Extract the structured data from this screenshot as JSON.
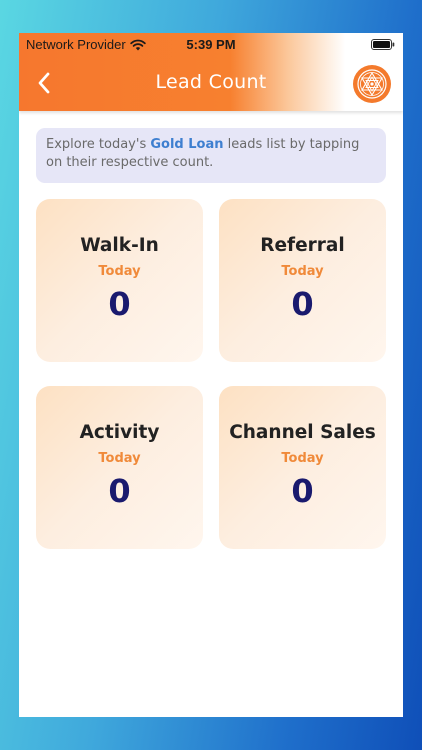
{
  "status_bar": {
    "carrier": "Network Provider",
    "time": "5:39 PM"
  },
  "nav": {
    "title": "Lead Count"
  },
  "banner": {
    "prefix": "Explore today's ",
    "highlight": "Gold Loan",
    "suffix": " leads list by tapping on their respective count."
  },
  "cards": [
    {
      "title": "Walk-In",
      "subtitle": "Today",
      "count": "0"
    },
    {
      "title": "Referral",
      "subtitle": "Today",
      "count": "0"
    },
    {
      "title": "Activity",
      "subtitle": "Today",
      "count": "0"
    },
    {
      "title": "Channel Sales",
      "subtitle": "Today",
      "count": "0"
    }
  ],
  "colors": {
    "header_orange": "#f6772e",
    "subtitle_orange": "#f08a3a",
    "count_navy": "#1a1a6e",
    "highlight_blue": "#3e7fd0",
    "banner_bg": "#e6e6f7"
  },
  "icons": {
    "back": "chevron-left-icon",
    "wifi": "wifi-icon",
    "battery": "battery-icon",
    "logo": "sri-yantra-logo-icon"
  }
}
